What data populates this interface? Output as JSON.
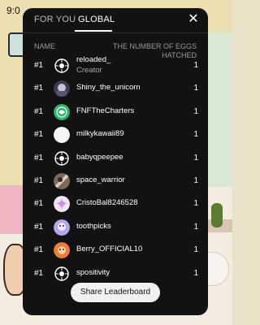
{
  "status_bar": {
    "time": "9:0"
  },
  "tabs": [
    {
      "label": "FOR YOU",
      "active": false
    },
    {
      "label": "GLOBAL",
      "active": true
    }
  ],
  "close_icon": "close-icon",
  "table": {
    "col_name": "NAME",
    "col_eggs": "THE NUMBER OF EGGS HATCHED",
    "rows": [
      {
        "rank": "#1",
        "name": "reloaded_",
        "subtitle": "Creator",
        "count": "1",
        "avatar": "emblem-avatar"
      },
      {
        "rank": "#1",
        "name": "Shiny_the_unicorn",
        "count": "1",
        "avatar": "character-avatar"
      },
      {
        "rank": "#1",
        "name": "FNFTheCharters",
        "count": "1",
        "avatar": "green-avatar"
      },
      {
        "rank": "#1",
        "name": "milkykawaii89",
        "count": "1",
        "avatar": "white-avatar"
      },
      {
        "rank": "#1",
        "name": "babyqpeepee",
        "count": "1",
        "avatar": "emblem-avatar"
      },
      {
        "rank": "#1",
        "name": "space_warrior",
        "count": "1",
        "avatar": "character-avatar"
      },
      {
        "rank": "#1",
        "name": "CristoBal8246528",
        "count": "1",
        "avatar": "sparkle-avatar"
      },
      {
        "rank": "#1",
        "name": "toothpicks",
        "count": "1",
        "avatar": "purple-avatar"
      },
      {
        "rank": "#1",
        "name": "Berry_OFFICIAL10",
        "count": "1",
        "avatar": "orange-avatar"
      },
      {
        "rank": "#1",
        "name": "spositivity",
        "count": "1",
        "avatar": "emblem-avatar"
      }
    ]
  },
  "share_button": {
    "label": "Share Leaderboard"
  },
  "colors": {
    "modal_bg": "#121212",
    "accent": "#ffffff"
  }
}
